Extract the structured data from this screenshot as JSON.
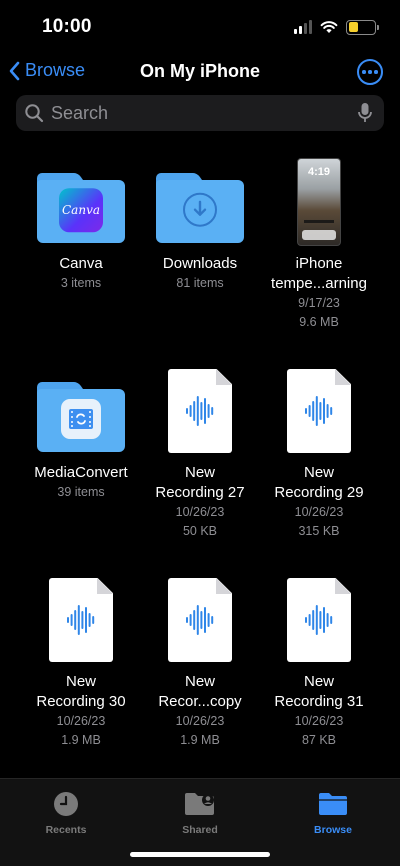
{
  "status_bar": {
    "time": "10:00"
  },
  "nav": {
    "back_label": "Browse",
    "title": "On My iPhone"
  },
  "search": {
    "placeholder": "Search"
  },
  "items": [
    {
      "name": "Canva",
      "meta1": "3 items",
      "icon": "canva-folder-icon"
    },
    {
      "name": "Downloads",
      "meta1": "81 items",
      "icon": "downloads-folder-icon"
    },
    {
      "name_line1": "iPhone",
      "name_line2": "tempe...arning",
      "meta1": "9/17/23",
      "meta2": "9.6 MB",
      "icon": "screenshot-thumbnail",
      "thumb_time": "4:19"
    },
    {
      "name": "MediaConvert",
      "meta1": "39 items",
      "icon": "mediaconvert-folder-icon"
    },
    {
      "name_line1": "New",
      "name_line2": "Recording 27",
      "meta1": "10/26/23",
      "meta2": "50 KB",
      "icon": "audio-file-icon"
    },
    {
      "name_line1": "New",
      "name_line2": "Recording 29",
      "meta1": "10/26/23",
      "meta2": "315 KB",
      "icon": "audio-file-icon"
    },
    {
      "name_line1": "New",
      "name_line2": "Recording 30",
      "meta1": "10/26/23",
      "meta2": "1.9 MB",
      "icon": "audio-file-icon"
    },
    {
      "name_line1": "New",
      "name_line2": "Recor...copy",
      "meta1": "10/26/23",
      "meta2": "1.9 MB",
      "icon": "audio-file-icon"
    },
    {
      "name_line1": "New",
      "name_line2": "Recording 31",
      "meta1": "10/26/23",
      "meta2": "87 KB",
      "icon": "audio-file-icon"
    }
  ],
  "tabbar": {
    "tabs": [
      {
        "label": "Recents",
        "icon": "clock-icon",
        "active": false
      },
      {
        "label": "Shared",
        "icon": "shared-folder-icon",
        "active": false
      },
      {
        "label": "Browse",
        "icon": "folder-icon",
        "active": true
      }
    ]
  },
  "colors": {
    "accent": "#3a8df6",
    "folder": "#5ab0f4",
    "battery": "#f7d02c",
    "audio_waveform": "#2f86e8"
  }
}
